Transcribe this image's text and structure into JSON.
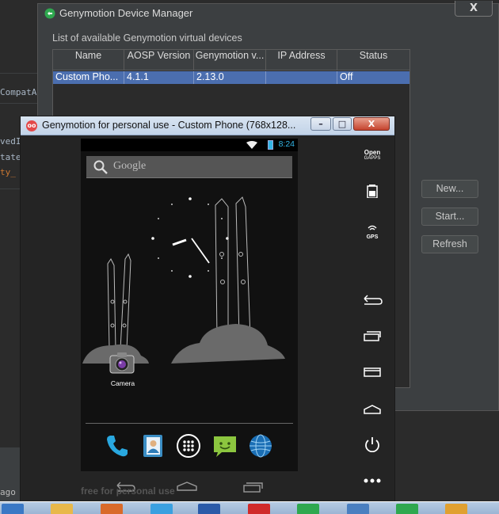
{
  "ide": {
    "code_lines": [
      "CompatA",
      "vedI",
      "tate",
      "ty_"
    ],
    "bottom_text": "ago"
  },
  "device_manager": {
    "title": "Genymotion Device Manager",
    "close_label": "X",
    "subtitle": "List of available Genymotion virtual devices",
    "columns": [
      "Name",
      "AOSP Version",
      "Genymotion v...",
      "IP Address",
      "Status"
    ],
    "rows": [
      {
        "name": "Custom Pho...",
        "aosp": "4.1.1",
        "genymotion": "2.13.0",
        "ip": "",
        "status": "Off"
      }
    ],
    "buttons": {
      "new": "New...",
      "start": "Start...",
      "refresh": "Refresh"
    }
  },
  "player": {
    "title": "Genymotion for personal use - Custom Phone (768x128...",
    "window_icon": "oo",
    "minimize": "–",
    "maximize": "□",
    "close": "X",
    "status_time": "8:24",
    "search_text": "Google",
    "camera_label": "Camera",
    "watermark": "free for personal use",
    "side": {
      "gapps_line1": "Open",
      "gapps_line2": "GAPPS",
      "gps_label": "GPS"
    }
  },
  "colors": {
    "holo_blue": "#33b5e5",
    "selection": "#4b6eaf"
  }
}
